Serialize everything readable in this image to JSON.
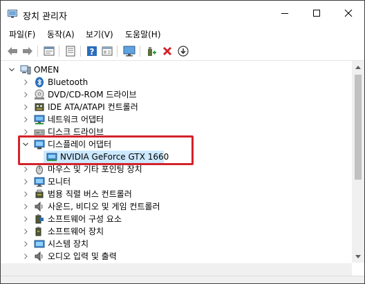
{
  "window": {
    "title": "장치 관리자",
    "controls": [
      "minimize",
      "maximize",
      "close"
    ]
  },
  "menu": [
    "파일(F)",
    "동작(A)",
    "보기(V)",
    "도움말(H)"
  ],
  "toolbar": {
    "icons": [
      "back-arrow-icon",
      "forward-arrow-icon",
      "properties-sheet-icon",
      "list-view-icon",
      "help-icon",
      "details-view-icon",
      "monitor-scan-icon",
      "add-driver-icon",
      "remove-x-icon",
      "download-driver-icon"
    ]
  },
  "tree": {
    "root": "OMEN",
    "items": [
      {
        "label": "Bluetooth",
        "icon": "bluetooth-icon"
      },
      {
        "label": "DVD/CD-ROM 드라이브",
        "icon": "dvd-drive-icon"
      },
      {
        "label": "IDE ATA/ATAPI 컨트롤러",
        "icon": "ide-controller-icon"
      },
      {
        "label": "네트워크 어댑터",
        "icon": "network-adapter-icon"
      },
      {
        "label": "디스크 드라이브",
        "icon": "disk-drive-icon"
      },
      {
        "label": "디스플레이 어댑터",
        "icon": "display-adapter-icon",
        "expanded": true
      },
      {
        "label": "NVIDIA GeForce GTX 1660",
        "icon": "gpu-icon",
        "child": true,
        "selected": true
      },
      {
        "label": "마우스 및 기타 포인팅 장치",
        "icon": "mouse-icon"
      },
      {
        "label": "모니터",
        "icon": "monitor-icon"
      },
      {
        "label": "범용 직렬 버스 컨트롤러",
        "icon": "usb-controller-icon"
      },
      {
        "label": "사운드, 비디오 및 게임 컨트롤러",
        "icon": "speaker-icon"
      },
      {
        "label": "소프트웨어 구성 요소",
        "icon": "software-component-icon"
      },
      {
        "label": "소프트웨어 장치",
        "icon": "software-device-icon"
      },
      {
        "label": "시스템 장치",
        "icon": "system-device-icon"
      },
      {
        "label": "오디오 입력 및 출력",
        "icon": "audio-io-icon"
      }
    ]
  },
  "colors": {
    "selection": "#cce8ff",
    "highlight_border": "#d3222a",
    "toolbar_blue": "#2a6ebc"
  }
}
